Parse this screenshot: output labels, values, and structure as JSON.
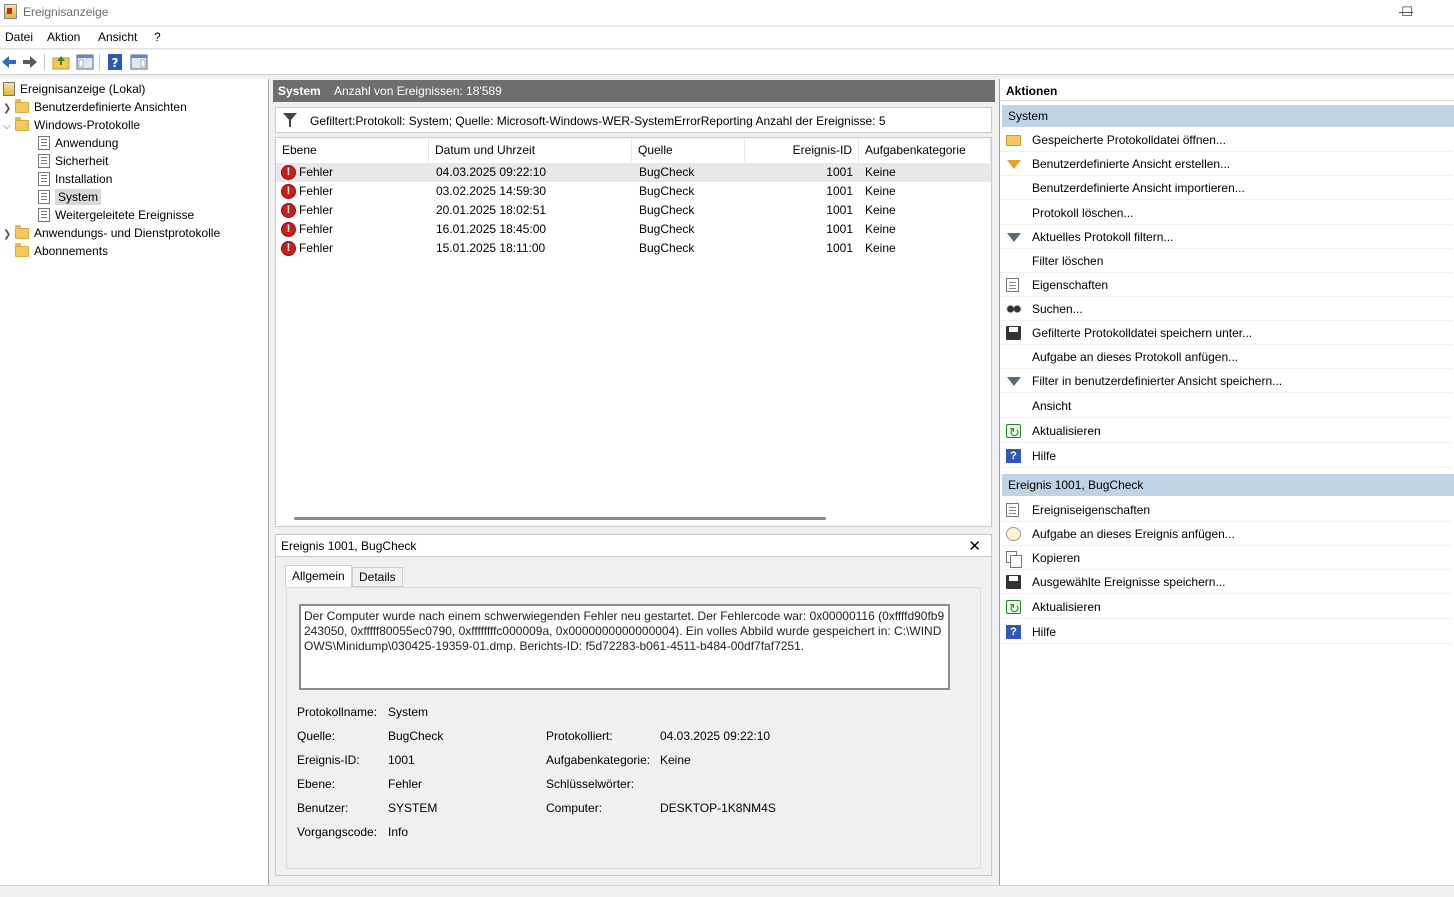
{
  "window": {
    "title": "Ereignisanzeige",
    "minimize": "—",
    "maximize": "☐"
  },
  "menu": {
    "items": [
      "Datei",
      "Aktion",
      "Ansicht",
      "?"
    ]
  },
  "tree": {
    "root": "Ereignisanzeige (Lokal)",
    "custom_views": "Benutzerdefinierte Ansichten",
    "windows_logs": "Windows-Protokolle",
    "logs": [
      "Anwendung",
      "Sicherheit",
      "Installation",
      "System",
      "Weitergeleitete Ereignisse"
    ],
    "app_service_logs": "Anwendungs- und Dienstprotokolle",
    "subscriptions": "Abonnements"
  },
  "list_header": {
    "title": "System",
    "count_text": "Anzahl von Ereignissen: 18'589"
  },
  "filter": {
    "text": "Gefiltert:Protokoll: System; Quelle: Microsoft-Windows-WER-SystemErrorReporting Anzahl der Ereignisse: 5"
  },
  "table": {
    "columns": [
      "Ebene",
      "Datum und Uhrzeit",
      "Quelle",
      "Ereignis-ID",
      "Aufgabenkategorie"
    ],
    "rows": [
      {
        "level": "Fehler",
        "datetime": "04.03.2025 09:22:10",
        "source": "BugCheck",
        "id": "1001",
        "category": "Keine"
      },
      {
        "level": "Fehler",
        "datetime": "03.02.2025 14:59:30",
        "source": "BugCheck",
        "id": "1001",
        "category": "Keine"
      },
      {
        "level": "Fehler",
        "datetime": "20.01.2025 18:02:51",
        "source": "BugCheck",
        "id": "1001",
        "category": "Keine"
      },
      {
        "level": "Fehler",
        "datetime": "16.01.2025 18:45:00",
        "source": "BugCheck",
        "id": "1001",
        "category": "Keine"
      },
      {
        "level": "Fehler",
        "datetime": "15.01.2025 18:11:00",
        "source": "BugCheck",
        "id": "1001",
        "category": "Keine"
      }
    ]
  },
  "detail": {
    "title": "Ereignis 1001, BugCheck",
    "close": "✕",
    "tabs": [
      "Allgemein",
      "Details"
    ],
    "description": "Der Computer wurde nach einem schwerwiegenden Fehler neu gestartet. Der Fehlercode war: 0x00000116 (0xffffd90fb9243050, 0xfffff80055ec0790, 0xffffffffc000009a, 0x0000000000000004). Ein volles Abbild wurde gespeichert in: C:\\WINDOWS\\Minidump\\030425-19359-01.dmp. Berichts-ID: f5d72283-b061-4511-b484-00df7faf7251.",
    "labels": {
      "log_name": "Protokollname:",
      "source": "Quelle:",
      "event_id": "Ereignis-ID:",
      "level": "Ebene:",
      "user": "Benutzer:",
      "opcode": "Vorgangscode:",
      "logged": "Protokolliert:",
      "task_category": "Aufgabenkategorie:",
      "keywords": "Schlüsselwörter:",
      "computer": "Computer:"
    },
    "values": {
      "log_name": "System",
      "source": "BugCheck",
      "event_id": "1001",
      "level": "Fehler",
      "user": "SYSTEM",
      "opcode": "Info",
      "logged": "04.03.2025 09:22:10",
      "task_category": "Keine",
      "keywords": "",
      "computer": "DESKTOP-1K8NM4S"
    }
  },
  "actions": {
    "title": "Aktionen",
    "section1": "System",
    "items1": [
      {
        "label": "Gespeicherte Protokolldatei öffnen...",
        "icon": "open-folder-icon"
      },
      {
        "label": "Benutzerdefinierte Ansicht erstellen...",
        "icon": "filter-icon"
      },
      {
        "label": "Benutzerdefinierte Ansicht importieren...",
        "icon": ""
      },
      {
        "label": "Protokoll löschen...",
        "icon": ""
      },
      {
        "label": "Aktuelles Protokoll filtern...",
        "icon": "filter-icon"
      },
      {
        "label": "Filter löschen",
        "icon": ""
      },
      {
        "label": "Eigenschaften",
        "icon": "properties-icon"
      },
      {
        "label": "Suchen...",
        "icon": "binoculars-icon"
      },
      {
        "label": "Gefilterte Protokolldatei speichern unter...",
        "icon": "save-icon"
      },
      {
        "label": "Aufgabe an dieses Protokoll anfügen...",
        "icon": ""
      },
      {
        "label": "Filter in benutzerdefinierter Ansicht speichern...",
        "icon": "filter-save-icon"
      },
      {
        "label": "Ansicht",
        "icon": ""
      },
      {
        "label": "Aktualisieren",
        "icon": "refresh-icon"
      },
      {
        "label": "Hilfe",
        "icon": "help-icon"
      }
    ],
    "section2": "Ereignis 1001, BugCheck",
    "items2": [
      {
        "label": "Ereigniseigenschaften",
        "icon": "properties-icon"
      },
      {
        "label": "Aufgabe an dieses Ereignis anfügen...",
        "icon": "task-icon"
      },
      {
        "label": "Kopieren",
        "icon": "copy-icon"
      },
      {
        "label": "Ausgewählte Ereignisse speichern...",
        "icon": "save-icon"
      },
      {
        "label": "Aktualisieren",
        "icon": "refresh-icon"
      },
      {
        "label": "Hilfe",
        "icon": "help-icon"
      }
    ]
  }
}
